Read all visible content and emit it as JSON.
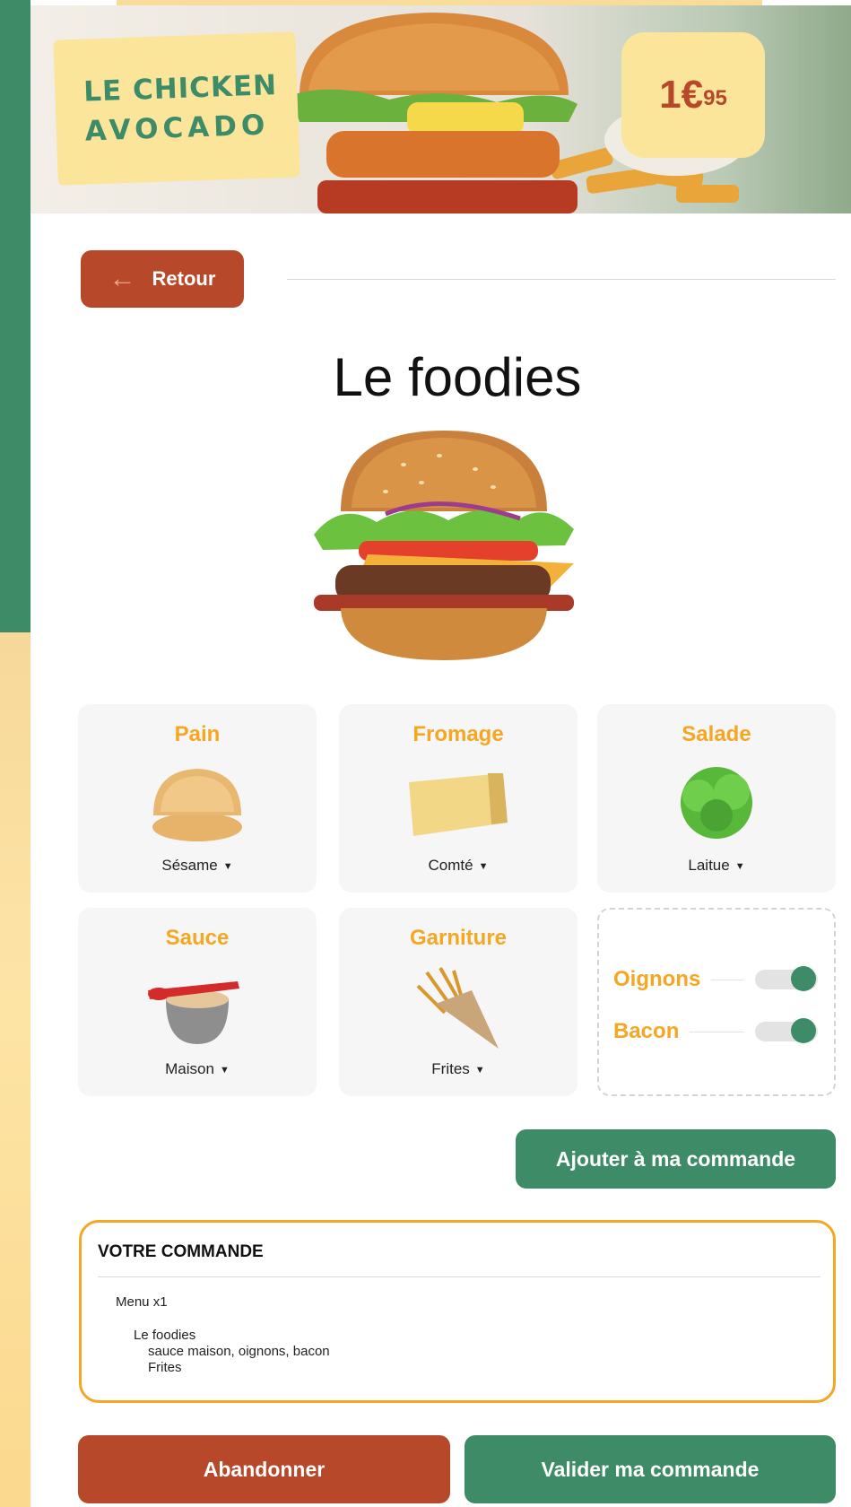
{
  "banner": {
    "title_line1": "LE CHICKEN",
    "title_line2": "AVOCADO",
    "price_main": "1€",
    "price_cents": "95"
  },
  "nav": {
    "back_label": "Retour"
  },
  "product": {
    "name": "Le foodies"
  },
  "options": [
    {
      "title": "Pain",
      "value": "Sésame"
    },
    {
      "title": "Fromage",
      "value": "Comté"
    },
    {
      "title": "Salade",
      "value": "Laitue"
    },
    {
      "title": "Sauce",
      "value": "Maison"
    },
    {
      "title": "Garniture",
      "value": "Frites"
    }
  ],
  "extras": [
    {
      "label": "Oignons",
      "enabled": true
    },
    {
      "label": "Bacon",
      "enabled": true
    }
  ],
  "add_button": "Ajouter à ma commande",
  "order": {
    "heading": "VOTRE COMMANDE",
    "menu_line": "Menu x1",
    "item_name": "Le foodies",
    "item_details": "sauce maison, oignons, bacon",
    "item_side": "Frites"
  },
  "actions": {
    "cancel": "Abandonner",
    "validate": "Valider ma commande"
  },
  "colors": {
    "green": "#3e8b67",
    "rust": "#b8482a",
    "orange": "#f5a623",
    "yellow": "#fbe59a"
  }
}
